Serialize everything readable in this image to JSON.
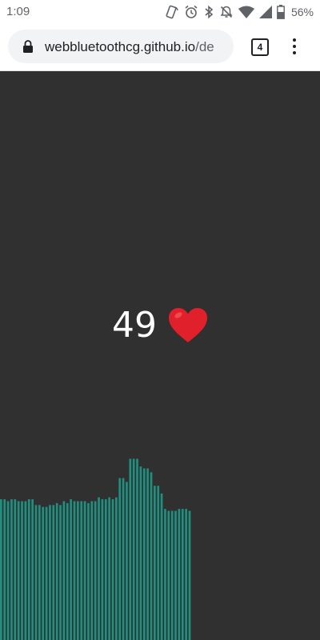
{
  "status_bar": {
    "time": "1:09",
    "battery_percent": "56%",
    "icons": [
      "nfc-phone-icon",
      "alarm-icon",
      "bluetooth-icon",
      "notifications-off-icon",
      "wifi-icon",
      "signal-icon",
      "battery-icon"
    ]
  },
  "browser": {
    "url_host": "webbluetoothcg.github.io",
    "url_path": "/de",
    "tab_count": "4"
  },
  "heart_rate": {
    "value": "49",
    "icon": "heart-icon",
    "heart_color": "#e0202a"
  },
  "chart_data": {
    "type": "bar",
    "bar_color": "#1f8f80",
    "ylim": [
      0,
      100
    ],
    "values": [
      73,
      73,
      72,
      73,
      73,
      72,
      72,
      72,
      73,
      73,
      70,
      70,
      69,
      69,
      70,
      70,
      71,
      70,
      72,
      71,
      73,
      72,
      72,
      72,
      72,
      71,
      72,
      72,
      74,
      73,
      73,
      74,
      73,
      74,
      84,
      84,
      82,
      94,
      94,
      94,
      90,
      89,
      89,
      87,
      80,
      80,
      76,
      68,
      67,
      67,
      67,
      68,
      68,
      68,
      67
    ]
  }
}
